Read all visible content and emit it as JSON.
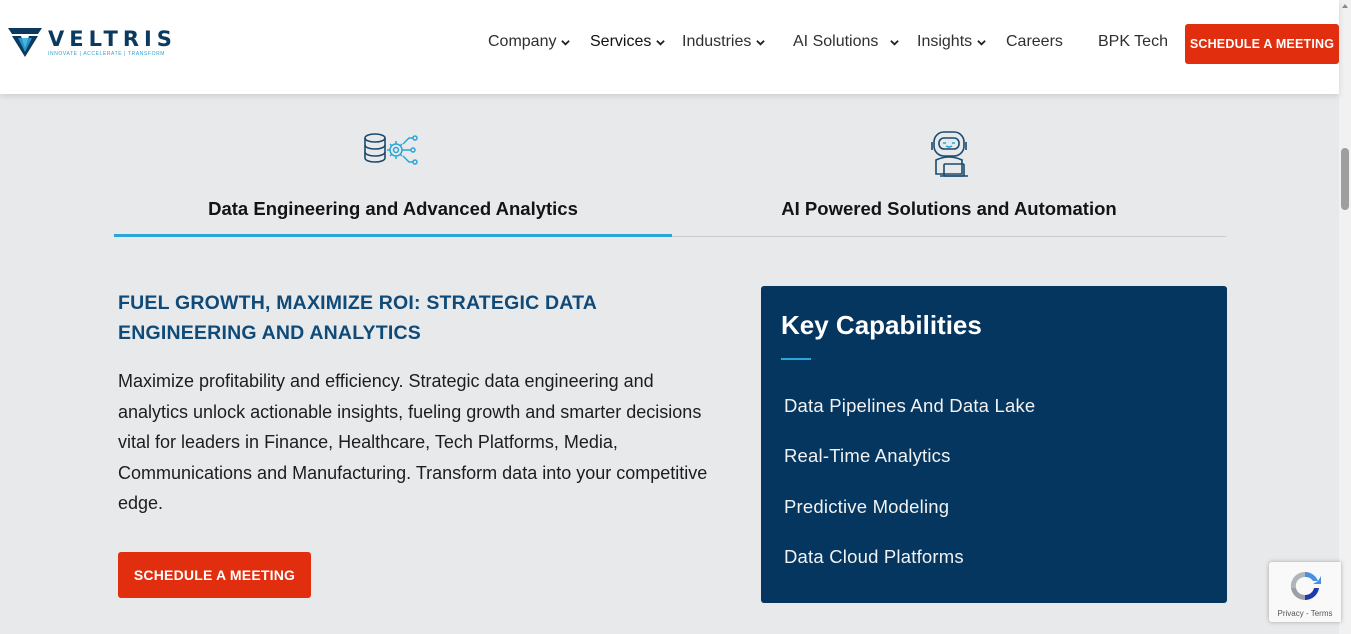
{
  "header": {
    "logo": {
      "name": "VELTRIS",
      "tagline": "INNOVATE | ACCELERATE | TRANSFORM"
    },
    "nav": [
      {
        "label": "Company",
        "has_dropdown": true
      },
      {
        "label": "Services",
        "has_dropdown": true
      },
      {
        "label": "Industries",
        "has_dropdown": true
      },
      {
        "label": "AI Solutions",
        "has_dropdown": true
      },
      {
        "label": "Insights",
        "has_dropdown": true
      },
      {
        "label": "Careers",
        "has_dropdown": false
      },
      {
        "label": "BPK Tech",
        "has_dropdown": false
      }
    ],
    "cta_label": "SCHEDULE A MEETING"
  },
  "tabs": [
    {
      "label": "Data Engineering and Advanced Analytics",
      "icon": "database-gear-icon",
      "active": true
    },
    {
      "label": "AI Powered Solutions and Automation",
      "icon": "robot-laptop-icon",
      "active": false
    }
  ],
  "content": {
    "headline": "FUEL GROWTH, MAXIMIZE ROI: STRATEGIC DATA ENGINEERING AND ANALYTICS",
    "body": "Maximize profitability and efficiency. Strategic data engineering and analytics unlock actionable insights, fueling growth and smarter decisions vital for leaders in Finance, Healthcare, Tech Platforms, Media, Communications and Manufacturing. Transform data into your competitive edge.",
    "cta_label": "SCHEDULE A MEETING"
  },
  "capabilities": {
    "title": "Key Capabilities",
    "items": [
      "Data Pipelines And Data Lake",
      "Real-Time Analytics",
      "Predictive Modeling",
      "Data Cloud Platforms"
    ]
  },
  "recaptcha": {
    "text": "Privacy - Terms"
  },
  "colors": {
    "accent_red": "#e02e0e",
    "brand_navy": "#05365f",
    "accent_cyan": "#2aa6d8",
    "headline_blue": "#0f4a78",
    "page_bg": "#e8e9eb"
  }
}
